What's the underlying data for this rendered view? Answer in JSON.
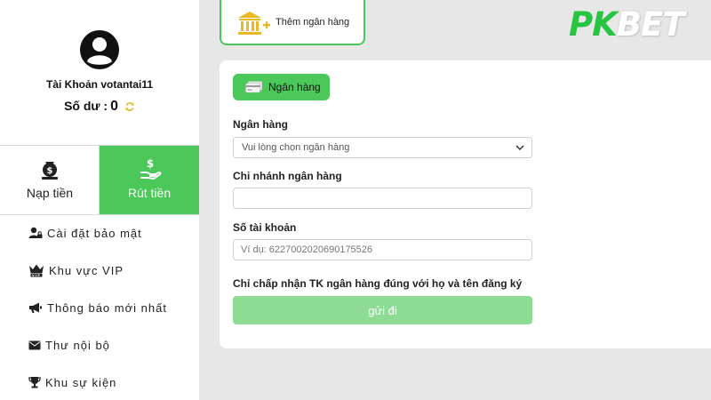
{
  "sidebar": {
    "account_label": "Tài Khoản votantai11",
    "balance_label": "Số dư :",
    "balance_value": "0",
    "deposit_label": "Nạp tiền",
    "withdraw_label": "Rút tiền",
    "menu": [
      {
        "label": "Cài đặt bảo mật",
        "icon": "user-lock-icon"
      },
      {
        "label": "Khu vực VIP",
        "icon": "vip-crown-icon"
      },
      {
        "label": "Thông báo mới nhất",
        "icon": "megaphone-icon"
      },
      {
        "label": "Thư nội bộ",
        "icon": "envelope-icon"
      },
      {
        "label": "Khu sự kiện",
        "icon": "trophy-icon"
      }
    ]
  },
  "header": {
    "add_bank_tab": "Thêm ngân hàng",
    "logo_part1": "PK",
    "logo_part2": "BET"
  },
  "form": {
    "pill_label": "Ngân hàng",
    "bank_label": "Ngân hàng",
    "bank_select_value": "Vui lòng chọn ngân hàng",
    "branch_label": "Chi nhánh ngân hàng",
    "branch_value": "",
    "account_number_label": "Số tài khoản",
    "account_number_placeholder": "Ví dụ: 6227002020690175526",
    "account_number_value": "",
    "notice": "Chỉ chấp nhận TK ngân hàng đúng với họ và tên đăng ký",
    "submit_label": "gửi đi"
  },
  "colors": {
    "accent": "#4cc75a",
    "submit_disabled": "#8edb94",
    "logo_green": "#26c441",
    "coin_yellow": "#e8b923"
  }
}
